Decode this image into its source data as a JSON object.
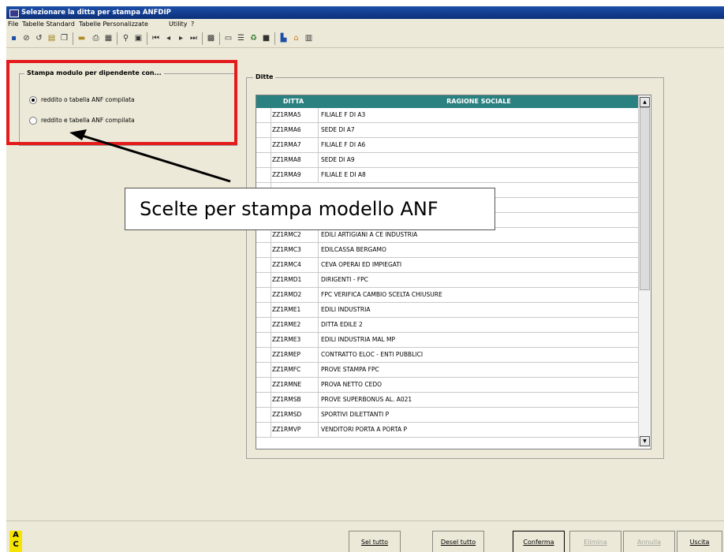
{
  "window": {
    "title": "Selezionare la ditta per stampa ANFDIP"
  },
  "menu": [
    "File",
    "Tabelle Standard",
    "Tabelle Personalizzate",
    "Utility",
    "?"
  ],
  "toolbar_icons": [
    "save-icon",
    "cancel-icon",
    "undo-icon",
    "paste-icon",
    "copy-icon",
    "folder-icon",
    "print-icon",
    "print-preview-icon",
    "find-icon",
    "find-next-icon",
    "first-record-icon",
    "prev-record-icon",
    "next-record-icon",
    "last-record-icon",
    "options-icon",
    "export-icon",
    "list-icon",
    "refresh-icon",
    "image-icon",
    "chart-icon",
    "home-icon",
    "calendar-icon"
  ],
  "print_options": {
    "title": "Stampa modulo per dipendente con...",
    "options": [
      {
        "label": "reddito o tabella ANF compilata",
        "selected": true
      },
      {
        "label": "reddito e tabella ANF compilata",
        "selected": false
      }
    ]
  },
  "ditte": {
    "title": "Ditte",
    "columns": [
      "DITTA",
      "RAGIONE SOCIALE"
    ],
    "rows": [
      {
        "code": "ZZ1RMA5",
        "name": "FILIALE F DI A3"
      },
      {
        "code": "ZZ1RMA6",
        "name": "SEDE DI A7"
      },
      {
        "code": "ZZ1RMA7",
        "name": "FILIALE F DI A6"
      },
      {
        "code": "ZZ1RMA8",
        "name": "SEDE DI A9"
      },
      {
        "code": "ZZ1RMA9",
        "name": "FILIALE E DI A8"
      },
      {
        "code": "",
        "name": ""
      },
      {
        "code": "",
        "name": ""
      },
      {
        "code": "",
        "name": ""
      },
      {
        "code": "ZZ1RMC2",
        "name": "EDILI ARTIGIANI A CE INDUSTRIA"
      },
      {
        "code": "ZZ1RMC3",
        "name": "EDILCASSA BERGAMO"
      },
      {
        "code": "ZZ1RMC4",
        "name": "CEVA OPERAI ED IMPIEGATI"
      },
      {
        "code": "ZZ1RMD1",
        "name": "DIRIGENTI - FPC"
      },
      {
        "code": "ZZ1RMD2",
        "name": "FPC VERIFICA CAMBIO SCELTA CHIUSURE"
      },
      {
        "code": "ZZ1RME1",
        "name": "EDILI INDUSTRIA"
      },
      {
        "code": "ZZ1RME2",
        "name": "DITTA EDILE 2"
      },
      {
        "code": "ZZ1RME3",
        "name": "EDILI INDUSTRIA MAL MP"
      },
      {
        "code": "ZZ1RMEP",
        "name": "CONTRATTO ELOC - ENTI PUBBLICI"
      },
      {
        "code": "ZZ1RMFC",
        "name": "PROVE STAMPA FPC"
      },
      {
        "code": "ZZ1RMNE",
        "name": "PROVA NETTO CEDO"
      },
      {
        "code": "ZZ1RMSB",
        "name": "PROVE SUPERBONUS AL. A021"
      },
      {
        "code": "ZZ1RMSD",
        "name": "SPORTIVI DILETTANTI P"
      },
      {
        "code": "ZZ1RMVP",
        "name": "VENDITORI PORTA A PORTA P"
      }
    ]
  },
  "callout": {
    "text": "Scelte per stampa modello ANF"
  },
  "bottom": {
    "logo": [
      "A",
      "C"
    ],
    "buttons": [
      "Sel tutto",
      "Desel tutto",
      "Conferma",
      "Elimina",
      "Annulla",
      "Uscita"
    ]
  },
  "colors": {
    "grid_header": "#2b8080",
    "highlight": "#e41b1b",
    "title_bar": "#0b2f7a",
    "logo": "#f5e400"
  }
}
